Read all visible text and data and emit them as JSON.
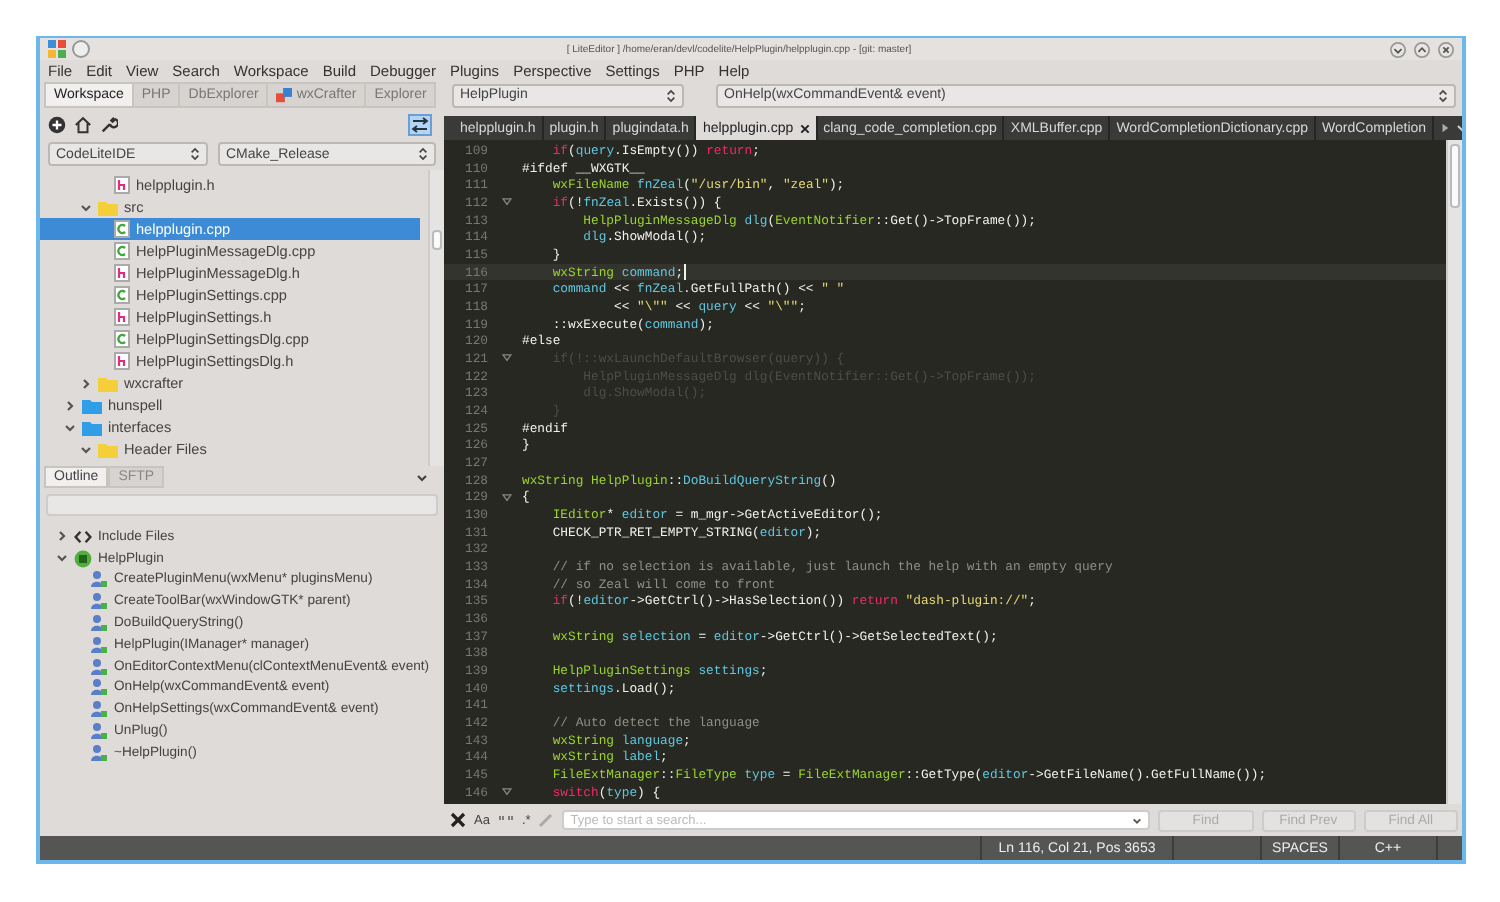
{
  "window": {
    "title": "[ LiteEditor ] /home/eran/devl/codelite/HelpPlugin/helpplugin.cpp - [git: master]"
  },
  "menu": [
    "File",
    "Edit",
    "View",
    "Search",
    "Workspace",
    "Build",
    "Debugger",
    "Plugins",
    "Perspective",
    "Settings",
    "PHP",
    "Help"
  ],
  "workspace_tabs": [
    {
      "label": "Workspace",
      "selected": true,
      "kind": "plain"
    },
    {
      "label": "PHP",
      "selected": false,
      "kind": "plain"
    },
    {
      "label": "DbExplorer",
      "selected": false,
      "kind": "plain"
    },
    {
      "label": "wxCrafter",
      "selected": false,
      "kind": "crafter"
    },
    {
      "label": "Explorer",
      "selected": false,
      "kind": "plain"
    }
  ],
  "build_selectors": {
    "project": "CodeLiteIDE",
    "configuration": "CMake_Release"
  },
  "project_tree": [
    {
      "children": [
        {
          "children": [
            {
              "label": "helpplugin.h",
              "kind": "header",
              "selected": false
            }
          ]
        },
        {
          "label": "src",
          "kind": "folder",
          "expanded": true,
          "selected": false,
          "children": [
            {
              "label": "helpplugin.cpp",
              "kind": "source",
              "selected": true
            },
            {
              "label": "HelpPluginMessageDlg.cpp",
              "kind": "source",
              "selected": false
            },
            {
              "label": "HelpPluginMessageDlg.h",
              "kind": "header",
              "selected": false
            },
            {
              "label": "HelpPluginSettings.cpp",
              "kind": "source",
              "selected": false
            },
            {
              "label": "HelpPluginSettings.h",
              "kind": "header",
              "selected": false
            },
            {
              "label": "HelpPluginSettingsDlg.cpp",
              "kind": "source",
              "selected": false
            },
            {
              "label": "HelpPluginSettingsDlg.h",
              "kind": "header",
              "selected": false
            }
          ]
        },
        {
          "label": "wxcrafter",
          "kind": "folder",
          "expanded": false,
          "selected": false
        }
      ]
    },
    {
      "label": "hunspell",
      "kind": "project",
      "expanded": false,
      "selected": false
    },
    {
      "label": "interfaces",
      "kind": "project",
      "expanded": true,
      "selected": false,
      "children": [
        {
          "label": "Header Files",
          "kind": "folder",
          "expanded": true,
          "selected": false
        }
      ]
    }
  ],
  "outline_tabs": [
    {
      "label": "Outline",
      "selected": true
    },
    {
      "label": "SFTP",
      "selected": false
    }
  ],
  "outline_tree": [
    {
      "label": "Include Files",
      "kind": "include",
      "expanded": false
    },
    {
      "label": "HelpPlugin",
      "kind": "class",
      "expanded": true,
      "children": [
        {
          "label": "CreatePluginMenu(wxMenu* pluginsMenu)",
          "kind": "method"
        },
        {
          "label": "CreateToolBar(wxWindowGTK* parent)",
          "kind": "method"
        },
        {
          "label": "DoBuildQueryString()",
          "kind": "method"
        },
        {
          "label": "HelpPlugin(IManager* manager)",
          "kind": "method"
        },
        {
          "label": "OnEditorContextMenu(clContextMenuEvent& event)",
          "kind": "method"
        },
        {
          "label": "OnHelp(wxCommandEvent& event)",
          "kind": "method"
        },
        {
          "label": "OnHelpSettings(wxCommandEvent& event)",
          "kind": "method"
        },
        {
          "label": "UnPlug()",
          "kind": "method"
        },
        {
          "label": "~HelpPlugin()",
          "kind": "method"
        }
      ]
    }
  ],
  "scope_selectors": {
    "class": "HelpPlugin",
    "function": "OnHelp(wxCommandEvent& event)"
  },
  "editor_tabs": [
    {
      "label": "helpplugin.h",
      "selected": false
    },
    {
      "label": "plugin.h",
      "selected": false
    },
    {
      "label": "plugindata.h",
      "selected": false
    },
    {
      "label": "helpplugin.cpp",
      "selected": true
    },
    {
      "label": "clang_code_completion.cpp",
      "selected": false
    },
    {
      "label": "XMLBuffer.cpp",
      "selected": false
    },
    {
      "label": "WordCompletionDictionary.cpp",
      "selected": false
    },
    {
      "label": "WordCompletion",
      "selected": false
    }
  ],
  "code_lines": [
    {
      "number": "109",
      "fold": false,
      "current": false,
      "segments": [
        {
          "kind": "keyword",
          "text": "    if"
        },
        {
          "kind": "plain",
          "text": "("
        },
        {
          "kind": "name",
          "text": "query"
        },
        {
          "kind": "plain",
          "text": ".IsEmpty()) "
        },
        {
          "kind": "keyword",
          "text": "return"
        },
        {
          "kind": "plain",
          "text": ";"
        }
      ]
    },
    {
      "number": "110",
      "fold": false,
      "current": false,
      "segments": [
        {
          "kind": "plain",
          "text": "#ifdef __WXGTK__"
        }
      ]
    },
    {
      "number": "111",
      "fold": false,
      "current": false,
      "segments": [
        {
          "kind": "type",
          "text": "    wxFileName"
        },
        {
          "kind": "name",
          "text": " fnZeal"
        },
        {
          "kind": "plain",
          "text": "("
        },
        {
          "kind": "string",
          "text": "\"/usr/bin\""
        },
        {
          "kind": "plain",
          "text": ", "
        },
        {
          "kind": "string",
          "text": "\"zeal\""
        },
        {
          "kind": "plain",
          "text": ");"
        }
      ]
    },
    {
      "number": "112",
      "fold": true,
      "current": false,
      "segments": [
        {
          "kind": "keyword",
          "text": "    if"
        },
        {
          "kind": "plain",
          "text": "(!"
        },
        {
          "kind": "name",
          "text": "fnZeal"
        },
        {
          "kind": "plain",
          "text": ".Exists()) {"
        }
      ]
    },
    {
      "number": "113",
      "fold": false,
      "current": false,
      "segments": [
        {
          "kind": "type",
          "text": "        HelpPluginMessageDlg"
        },
        {
          "kind": "name",
          "text": " dlg"
        },
        {
          "kind": "plain",
          "text": "("
        },
        {
          "kind": "type",
          "text": "EventNotifier"
        },
        {
          "kind": "plain",
          "text": "::Get()->TopFrame());"
        }
      ]
    },
    {
      "number": "114",
      "fold": false,
      "current": false,
      "segments": [
        {
          "kind": "name",
          "text": "        dlg"
        },
        {
          "kind": "plain",
          "text": ".ShowModal();"
        }
      ]
    },
    {
      "number": "115",
      "fold": false,
      "current": false,
      "segments": [
        {
          "kind": "plain",
          "text": "    }"
        }
      ]
    },
    {
      "number": "116",
      "fold": false,
      "current": true,
      "segments": [
        {
          "kind": "type",
          "text": "    wxString"
        },
        {
          "kind": "name",
          "text": " command"
        },
        {
          "kind": "plain",
          "text": ";"
        }
      ]
    },
    {
      "number": "117",
      "fold": false,
      "current": false,
      "segments": [
        {
          "kind": "name",
          "text": "    command"
        },
        {
          "kind": "plain",
          "text": " << "
        },
        {
          "kind": "name",
          "text": "fnZeal"
        },
        {
          "kind": "plain",
          "text": ".GetFullPath() << "
        },
        {
          "kind": "string",
          "text": "\" \""
        }
      ]
    },
    {
      "number": "118",
      "fold": false,
      "current": false,
      "segments": [
        {
          "kind": "plain",
          "text": "            << "
        },
        {
          "kind": "string",
          "text": "\"\\\"\""
        },
        {
          "kind": "plain",
          "text": " << "
        },
        {
          "kind": "name",
          "text": "query"
        },
        {
          "kind": "plain",
          "text": " << "
        },
        {
          "kind": "string",
          "text": "\"\\\"\""
        },
        {
          "kind": "plain",
          "text": ";"
        }
      ]
    },
    {
      "number": "119",
      "fold": false,
      "current": false,
      "segments": [
        {
          "kind": "plain",
          "text": "    ::wxExecute("
        },
        {
          "kind": "name",
          "text": "command"
        },
        {
          "kind": "plain",
          "text": ");"
        }
      ]
    },
    {
      "number": "120",
      "fold": false,
      "current": false,
      "segments": [
        {
          "kind": "plain",
          "text": "#else"
        }
      ]
    },
    {
      "number": "121",
      "fold": true,
      "current": false,
      "segments": [
        {
          "kind": "inactive",
          "text": "    if(!::wxLaunchDefaultBrowser(query)) {"
        }
      ]
    },
    {
      "number": "122",
      "fold": false,
      "current": false,
      "segments": [
        {
          "kind": "inactive",
          "text": "        HelpPluginMessageDlg dlg(EventNotifier::Get()->TopFrame());"
        }
      ]
    },
    {
      "number": "123",
      "fold": false,
      "current": false,
      "segments": [
        {
          "kind": "inactive",
          "text": "        dlg.ShowModal();"
        }
      ]
    },
    {
      "number": "124",
      "fold": false,
      "current": false,
      "segments": [
        {
          "kind": "inactive",
          "text": "    }"
        }
      ]
    },
    {
      "number": "125",
      "fold": false,
      "current": false,
      "segments": [
        {
          "kind": "plain",
          "text": "#endif"
        }
      ]
    },
    {
      "number": "126",
      "fold": false,
      "current": false,
      "segments": [
        {
          "kind": "plain",
          "text": "}"
        }
      ]
    },
    {
      "number": "127",
      "fold": false,
      "current": false
    },
    {
      "number": "128",
      "fold": false,
      "current": false,
      "segments": [
        {
          "kind": "type",
          "text": "wxString HelpPlugin"
        },
        {
          "kind": "plain",
          "text": "::"
        },
        {
          "kind": "name",
          "text": "DoBuildQueryString"
        },
        {
          "kind": "plain",
          "text": "()"
        }
      ]
    },
    {
      "number": "129",
      "fold": true,
      "current": false,
      "segments": [
        {
          "kind": "plain",
          "text": "{"
        }
      ]
    },
    {
      "number": "130",
      "fold": false,
      "current": false,
      "segments": [
        {
          "kind": "type",
          "text": "    IEditor"
        },
        {
          "kind": "plain",
          "text": "* "
        },
        {
          "kind": "name",
          "text": "editor"
        },
        {
          "kind": "plain",
          "text": " = m_mgr->GetActiveEditor();"
        }
      ]
    },
    {
      "number": "131",
      "fold": false,
      "current": false,
      "segments": [
        {
          "kind": "plain",
          "text": "    CHECK_PTR_RET_EMPTY_STRING("
        },
        {
          "kind": "name",
          "text": "editor"
        },
        {
          "kind": "plain",
          "text": ");"
        }
      ]
    },
    {
      "number": "132",
      "fold": false,
      "current": false
    },
    {
      "number": "133",
      "fold": false,
      "current": false,
      "segments": [
        {
          "kind": "comment",
          "text": "    // if no selection is available, just launch the help with an empty query"
        }
      ]
    },
    {
      "number": "134",
      "fold": false,
      "current": false,
      "segments": [
        {
          "kind": "comment",
          "text": "    // so Zeal will come to front"
        }
      ]
    },
    {
      "number": "135",
      "fold": false,
      "current": false,
      "segments": [
        {
          "kind": "keyword",
          "text": "    if"
        },
        {
          "kind": "plain",
          "text": "(!"
        },
        {
          "kind": "name",
          "text": "editor"
        },
        {
          "kind": "plain",
          "text": "->GetCtrl()->HasSelection()) "
        },
        {
          "kind": "keyword",
          "text": "return"
        },
        {
          "kind": "string",
          "text": " \"dash-plugin://\""
        },
        {
          "kind": "plain",
          "text": ";"
        }
      ]
    },
    {
      "number": "136",
      "fold": false,
      "current": false
    },
    {
      "number": "137",
      "fold": false,
      "current": false,
      "segments": [
        {
          "kind": "type",
          "text": "    wxString"
        },
        {
          "kind": "name",
          "text": " selection"
        },
        {
          "kind": "plain",
          "text": " = "
        },
        {
          "kind": "name",
          "text": "editor"
        },
        {
          "kind": "plain",
          "text": "->GetCtrl()->GetSelectedText();"
        }
      ]
    },
    {
      "number": "138",
      "fold": false,
      "current": false
    },
    {
      "number": "139",
      "fold": false,
      "current": false,
      "segments": [
        {
          "kind": "type",
          "text": "    HelpPluginSettings"
        },
        {
          "kind": "name",
          "text": " settings"
        },
        {
          "kind": "plain",
          "text": ";"
        }
      ]
    },
    {
      "number": "140",
      "fold": false,
      "current": false,
      "segments": [
        {
          "kind": "name",
          "text": "    settings"
        },
        {
          "kind": "plain",
          "text": ".Load();"
        }
      ]
    },
    {
      "number": "141",
      "fold": false,
      "current": false
    },
    {
      "number": "142",
      "fold": false,
      "current": false,
      "segments": [
        {
          "kind": "comment",
          "text": "    // Auto detect the language"
        }
      ]
    },
    {
      "number": "143",
      "fold": false,
      "current": false,
      "segments": [
        {
          "kind": "type",
          "text": "    wxString"
        },
        {
          "kind": "name",
          "text": " language"
        },
        {
          "kind": "plain",
          "text": ";"
        }
      ]
    },
    {
      "number": "144",
      "fold": false,
      "current": false,
      "segments": [
        {
          "kind": "type",
          "text": "    wxString"
        },
        {
          "kind": "name",
          "text": " label"
        },
        {
          "kind": "plain",
          "text": ";"
        }
      ]
    },
    {
      "number": "145",
      "fold": false,
      "current": false,
      "segments": [
        {
          "kind": "type",
          "text": "    FileExtManager"
        },
        {
          "kind": "plain",
          "text": "::"
        },
        {
          "kind": "type",
          "text": "FileType"
        },
        {
          "kind": "name",
          "text": " type"
        },
        {
          "kind": "plain",
          "text": " = "
        },
        {
          "kind": "type",
          "text": "FileExtManager"
        },
        {
          "kind": "plain",
          "text": "::GetType("
        },
        {
          "kind": "name",
          "text": "editor"
        },
        {
          "kind": "plain",
          "text": "->GetFileName().GetFullName());"
        }
      ]
    },
    {
      "number": "146",
      "fold": true,
      "current": false,
      "segments": [
        {
          "kind": "keyword",
          "text": "    switch"
        },
        {
          "kind": "plain",
          "text": "("
        },
        {
          "kind": "name",
          "text": "type"
        },
        {
          "kind": "plain",
          "text": ") {"
        }
      ]
    }
  ],
  "find_bar": {
    "case_toggle": "Aa",
    "regex_toggle": ".*",
    "placeholder": "Type to start a search...",
    "buttons": [
      {
        "label": "Find",
        "disabled": true
      },
      {
        "label": "Find Prev",
        "disabled": true
      },
      {
        "label": "Find All",
        "disabled": true
      }
    ]
  },
  "status_bar": {
    "position": "Ln 116, Col 21, Pos 3653",
    "indentation": "SPACES",
    "language": "C++"
  }
}
